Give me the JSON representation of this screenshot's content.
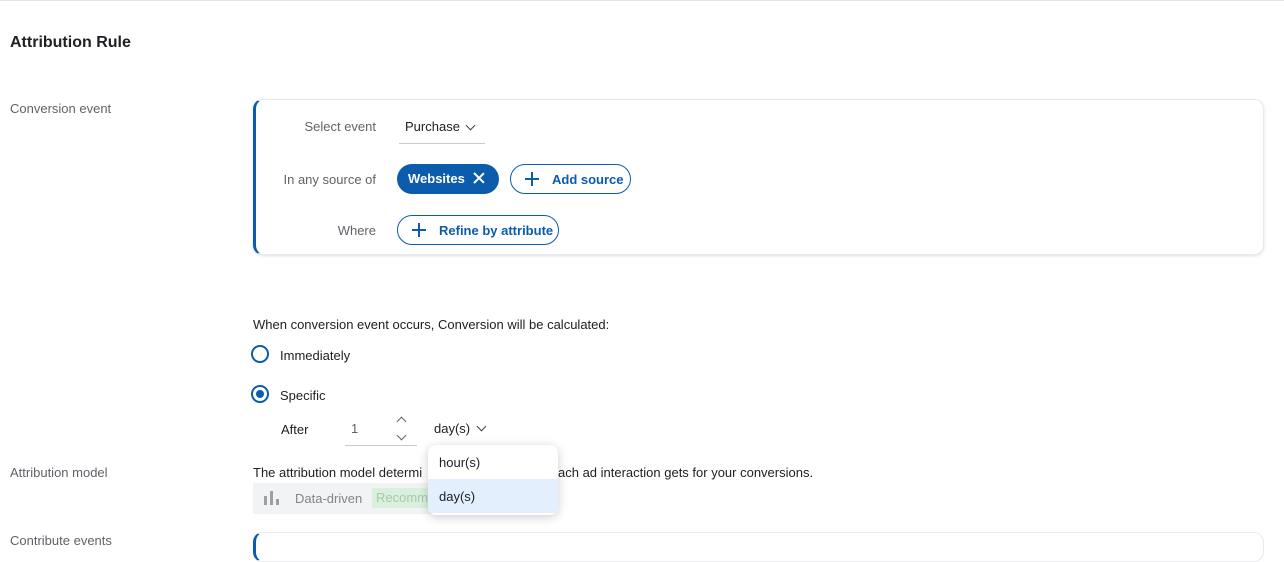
{
  "page": {
    "title": "Attribution Rule"
  },
  "labels": {
    "conversion_event": "Conversion event",
    "attribution_model": "Attribution model",
    "contribute_events": "Contribute events"
  },
  "conversion_card": {
    "select_event_label": "Select event",
    "select_event_value": "Purchase",
    "source_label": "In any source of",
    "source_chip": "Websites",
    "add_source": "Add source",
    "where_label": "Where",
    "refine_button": "Refine by attribute"
  },
  "calculation": {
    "heading": "When conversion event occurs, Conversion will be calculated:",
    "options": [
      {
        "label": "Immediately",
        "selected": false
      },
      {
        "label": "Specific",
        "selected": true
      }
    ],
    "after_label": "After",
    "after_value": "1",
    "unit_value": "day(s)"
  },
  "unit_dropdown": {
    "options": [
      {
        "label": "hour(s)",
        "selected": false
      },
      {
        "label": "day(s)",
        "selected": true
      }
    ]
  },
  "attribution": {
    "description_left": "The attribution model determi",
    "description_right": "ach ad interaction gets for your conversions.",
    "model_icon": "bar-chart-icon",
    "model_label": "Data-driven",
    "badge": "Recommended"
  },
  "colors": {
    "accent": "#0b5cad",
    "selected_item_bg": "#e3effc",
    "badge_bg": "#d9f0dc"
  }
}
